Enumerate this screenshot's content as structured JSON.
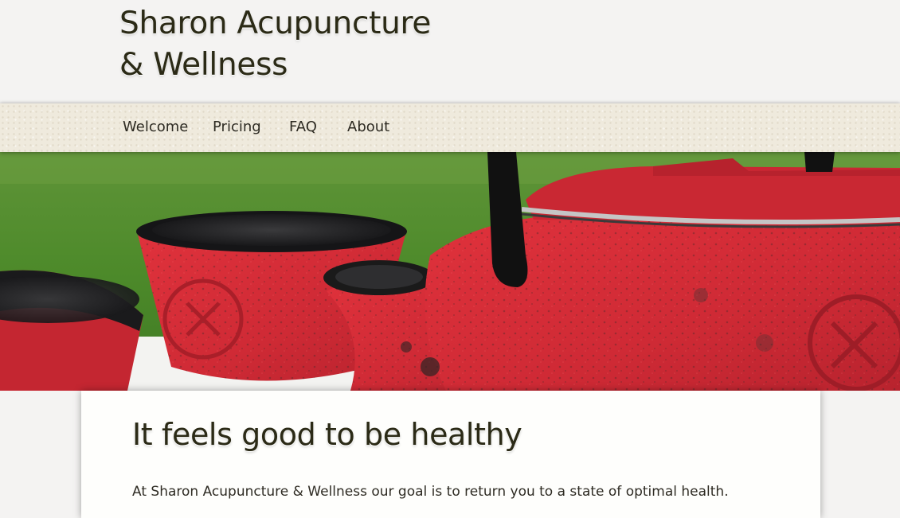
{
  "site": {
    "title_line1": "Sharon Acupuncture",
    "title_line2": "& Wellness"
  },
  "nav": {
    "items": [
      {
        "label": "Welcome"
      },
      {
        "label": "Pricing"
      },
      {
        "label": "FAQ"
      },
      {
        "label": "About"
      }
    ]
  },
  "hero": {
    "image": "red-cast-iron-teapot-and-cups-photo"
  },
  "main": {
    "headline": "It feels good to be healthy",
    "intro": "At Sharon Acupuncture & Wellness our goal is to return you to a state of optimal health."
  },
  "colors": {
    "background": "#f4f3f2",
    "nav_background": "#efeadd",
    "title_text": "#2b2a16",
    "teapot_red": "#d42a35",
    "grass_green": "#4f8a2d",
    "content_background": "#fefefc"
  }
}
